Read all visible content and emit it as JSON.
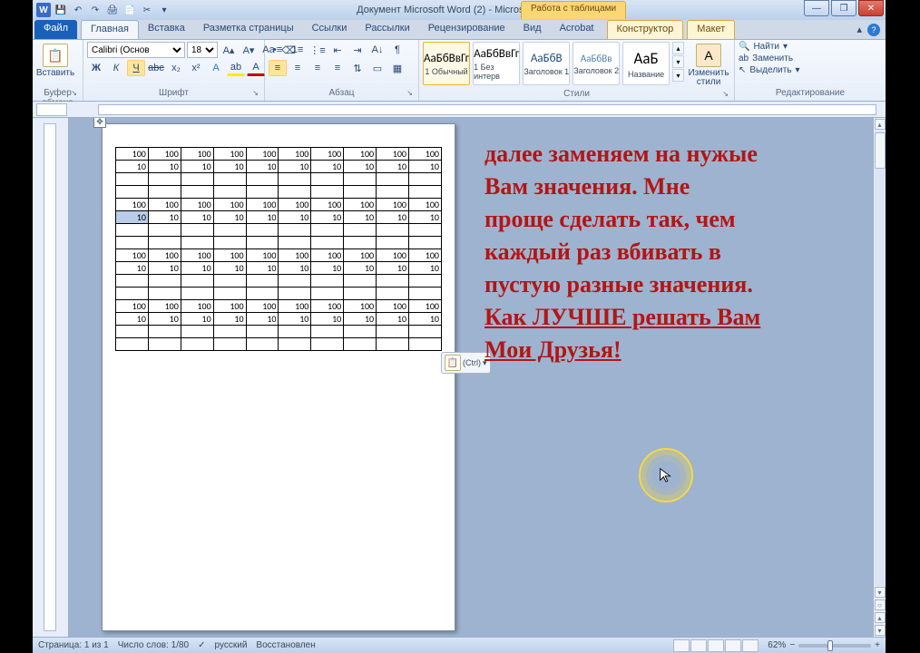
{
  "title": {
    "document": "Документ Microsoft Word (2)",
    "app": "Microsoft Word",
    "context_tab": "Работа с таблицами"
  },
  "tabs": {
    "file": "Файл",
    "home": "Главная",
    "insert": "Вставка",
    "layout": "Разметка страницы",
    "references": "Ссылки",
    "mailings": "Рассылки",
    "review": "Рецензирование",
    "view": "Вид",
    "acrobat": "Acrobat",
    "ctx_design": "Конструктор",
    "ctx_layout": "Макет"
  },
  "ribbon": {
    "clipboard": {
      "label": "Буфер обмена",
      "paste": "Вставить"
    },
    "font": {
      "label": "Шрифт",
      "family": "Calibri (Основ",
      "size": "18"
    },
    "paragraph": {
      "label": "Абзац"
    },
    "styles": {
      "label": "Стили",
      "preview": "АаБбВвГг",
      "preview_h": "АаБбВ",
      "preview_h2": "АаБбВв",
      "preview_t": "АаБ",
      "normal": "1 Обычный",
      "nospace": "1 Без интерв",
      "h1": "Заголовок 1",
      "h2": "Заголовок 2",
      "title": "Название",
      "change": "Изменить стили"
    },
    "editing": {
      "label": "Редактирование",
      "find": "Найти",
      "replace": "Заменить",
      "select": "Выделить"
    }
  },
  "doc_table": {
    "row100": [
      "100",
      "100",
      "100",
      "100",
      "100",
      "100",
      "100",
      "100",
      "100",
      "100"
    ],
    "row10": [
      "10",
      "10",
      "10",
      "10",
      "10",
      "10",
      "10",
      "10",
      "10",
      "10"
    ],
    "blank": [
      "",
      "",
      "",
      "",
      "",
      "",
      "",
      "",
      "",
      ""
    ]
  },
  "overlay": {
    "l1": "далее заменяем на нужые",
    "l2": "Вам значения. Мне",
    "l3": "проще сделать так, чем",
    "l4": "каждый раз вбивать в",
    "l5": "пустую разные значения.",
    "l6": "Как ЛУЧШЕ решать Вам",
    "l7": "Мои Друзья!"
  },
  "paste_ctrl": "(Ctrl)",
  "status": {
    "page": "Страница: 1 из 1",
    "words": "Число слов: 1/80",
    "lang": "русский",
    "recover": "Восстановлен",
    "zoom": "62%"
  }
}
